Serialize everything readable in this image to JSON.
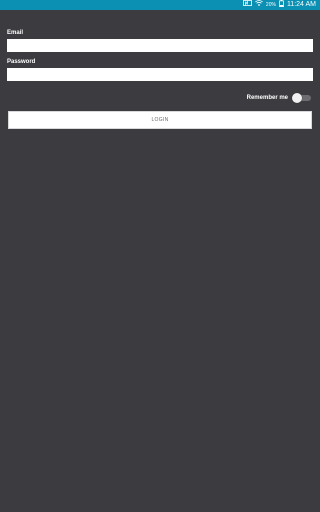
{
  "status_bar": {
    "battery_percent": "20%",
    "time": "11:24 AM",
    "icons": [
      "nfc-icon",
      "wifi-icon",
      "battery-icon"
    ],
    "background_color": "#0b8fb3"
  },
  "form": {
    "email": {
      "label": "Email",
      "value": "",
      "placeholder": ""
    },
    "password": {
      "label": "Password",
      "value": "",
      "placeholder": ""
    },
    "remember_me": {
      "label": "Remember me",
      "checked": false
    },
    "login_button": {
      "label": "LOGIN"
    }
  },
  "theme": {
    "background": "#3c3b3f",
    "input_background": "#ffffff"
  }
}
